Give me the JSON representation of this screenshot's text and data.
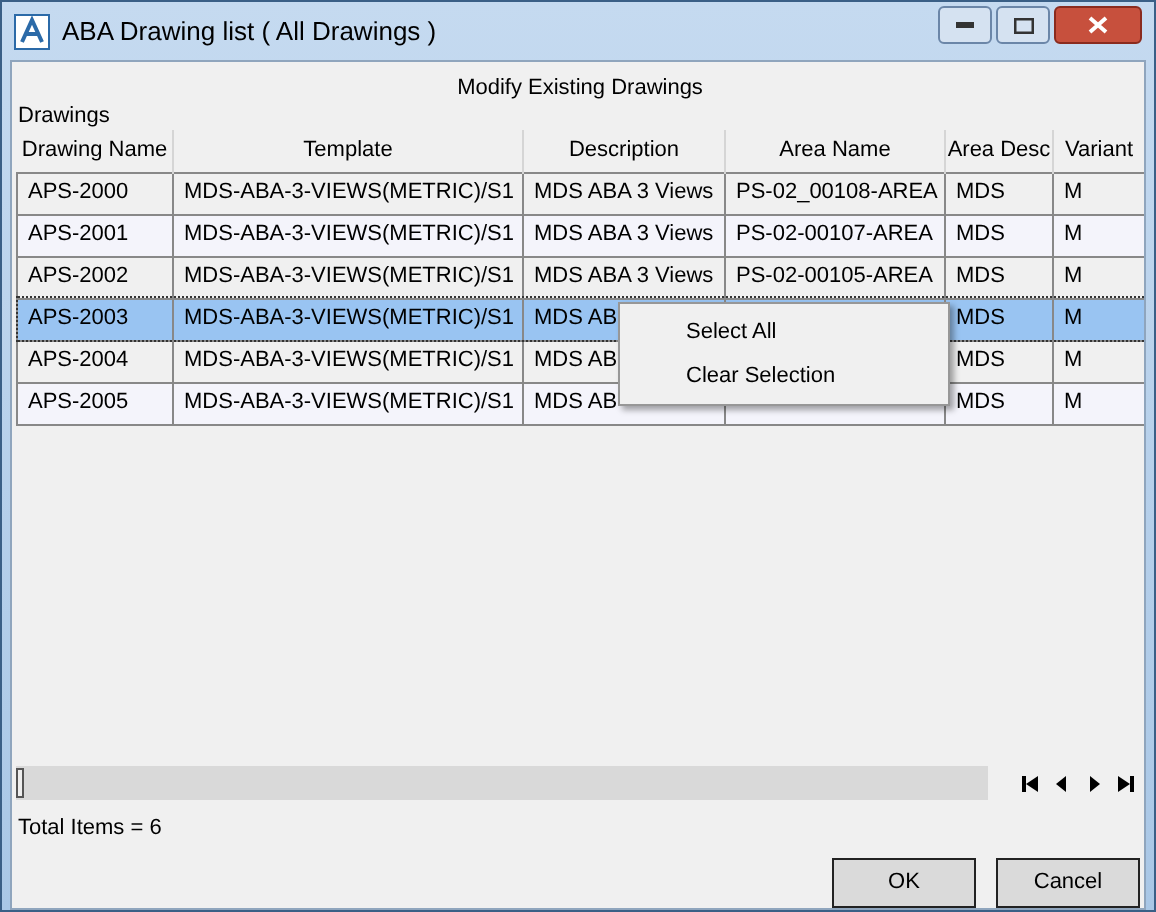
{
  "window": {
    "title": "ABA Drawing list ( All Drawings )"
  },
  "heading": "Modify Existing Drawings",
  "group_label": "Drawings",
  "table": {
    "columns": [
      "Drawing Name",
      "Template",
      "Description",
      "Area Name",
      "Area Desc",
      "Variant"
    ],
    "rows": [
      {
        "selected": false,
        "cells": [
          "APS-2000",
          "MDS-ABA-3-VIEWS(METRIC)/S1",
          "MDS ABA 3 Views",
          "PS-02_00108-AREA",
          "MDS",
          "M"
        ]
      },
      {
        "selected": false,
        "cells": [
          "APS-2001",
          "MDS-ABA-3-VIEWS(METRIC)/S1",
          "MDS ABA 3 Views",
          "PS-02-00107-AREA",
          "MDS",
          "M"
        ]
      },
      {
        "selected": false,
        "cells": [
          "APS-2002",
          "MDS-ABA-3-VIEWS(METRIC)/S1",
          "MDS ABA 3 Views",
          "PS-02-00105-AREA",
          "MDS",
          "M"
        ]
      },
      {
        "selected": true,
        "cells": [
          "APS-2003",
          "MDS-ABA-3-VIEWS(METRIC)/S1",
          "MDS AB",
          null,
          "MDS",
          "M"
        ]
      },
      {
        "selected": false,
        "cells": [
          "APS-2004",
          "MDS-ABA-3-VIEWS(METRIC)/S1",
          "MDS AB",
          null,
          "MDS",
          "M"
        ]
      },
      {
        "selected": false,
        "cells": [
          "APS-2005",
          "MDS-ABA-3-VIEWS(METRIC)/S1",
          "MDS AB",
          null,
          "MDS",
          "M"
        ]
      }
    ]
  },
  "context_menu": [
    "Select All",
    "Clear Selection"
  ],
  "status": "Total Items = 6",
  "buttons": [
    "OK",
    "Cancel"
  ]
}
